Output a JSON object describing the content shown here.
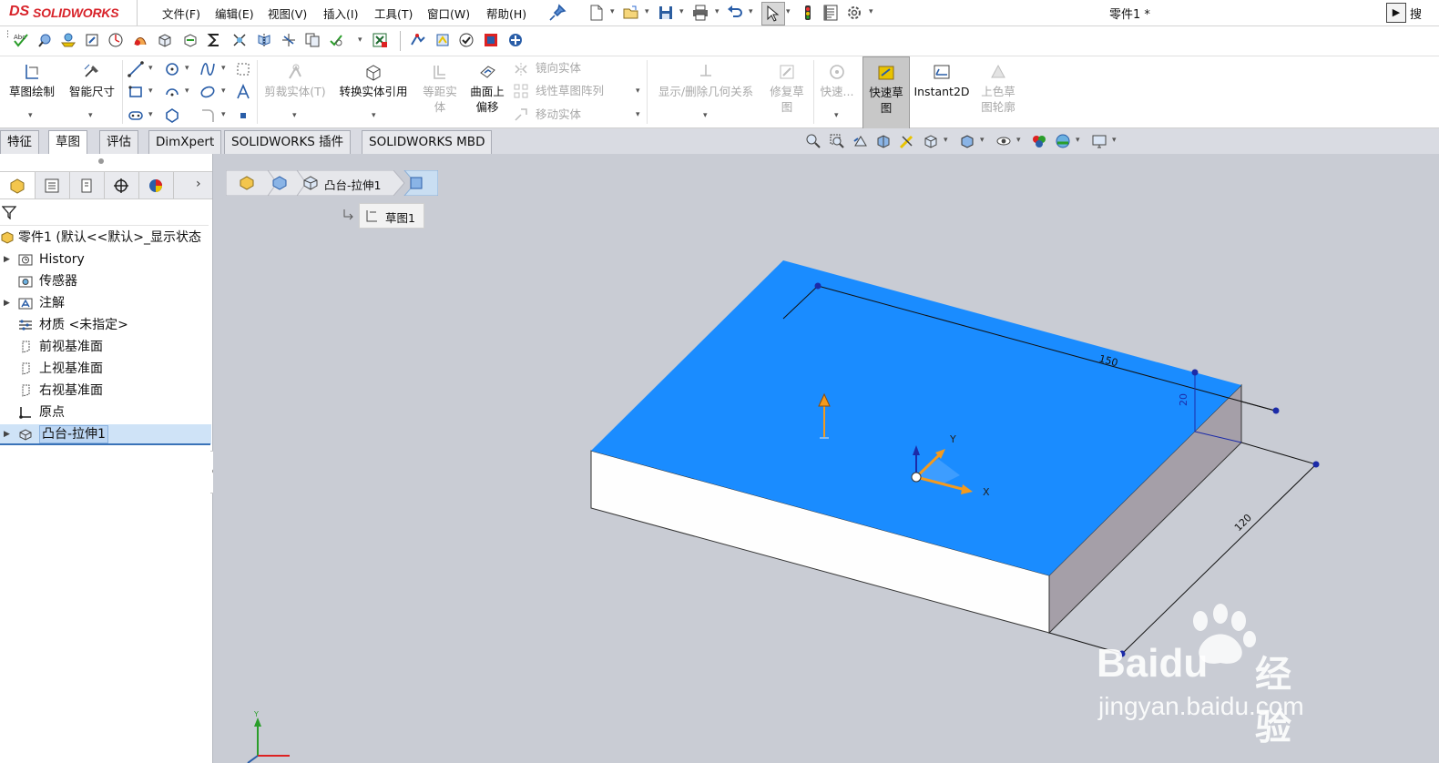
{
  "titlebar": {
    "logo_ds": "DS",
    "logo_text": "SOLIDWORKS",
    "menus": [
      "文件(F)",
      "编辑(E)",
      "视图(V)",
      "插入(I)",
      "工具(T)",
      "窗口(W)",
      "帮助(H)"
    ],
    "doc_title": "零件1 *",
    "search_label": "搜"
  },
  "command_manager": {
    "sketch": "草图绘制",
    "smart_dim": "智能尺寸",
    "trim": "剪裁实体(T)",
    "convert": "转换实体引用",
    "offset_line1": "等距实",
    "offset_line2": "体",
    "surface_offset_line1": "曲面上",
    "surface_offset_line2": "偏移",
    "mirror": "镜向实体",
    "linear_pattern": "线性草图阵列",
    "move": "移动实体",
    "display_relations": "显示/删除几何关系",
    "repair_line1": "修复草",
    "repair_line2": "图",
    "quick_snaps": "快速...",
    "rapid_sketch_line1": "快速草",
    "rapid_sketch_line2": "图",
    "instant2d": "Instant2D",
    "shaded_line1": "上色草",
    "shaded_line2": "图轮廓"
  },
  "tabs": [
    "特征",
    "草图",
    "评估",
    "DimXpert",
    "SOLIDWORKS 插件",
    "SOLIDWORKS MBD"
  ],
  "active_tab": "草图",
  "tree": {
    "root": "零件1  (默认<<默认>_显示状态",
    "items": [
      "History",
      "传感器",
      "注解",
      "材质 <未指定>",
      "前视基准面",
      "上视基准面",
      "右视基准面",
      "原点",
      "凸台-拉伸1"
    ]
  },
  "breadcrumb": {
    "feature": "凸台-拉伸1",
    "sketch": "草图1"
  },
  "model": {
    "dim_length": "150",
    "dim_height": "20",
    "dim_width": "120",
    "axis_x": "X",
    "axis_y": "Y",
    "face_color": "#1a8cff",
    "side_color": "#a59fa8"
  },
  "watermark": {
    "brand": "Baidu",
    "brand_cn": "经验",
    "url": "jingyan.baidu.com"
  }
}
